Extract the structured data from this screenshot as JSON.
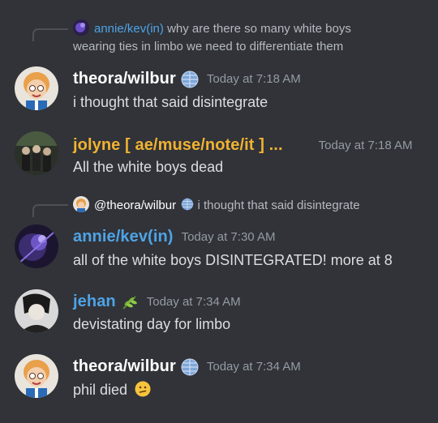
{
  "messages": [
    {
      "reply": {
        "author": "annie/kev(in)",
        "text": "why are there so many white boys wearing ties in limbo we need to differentiate them"
      },
      "author": "theora/wilbur",
      "time": "Today at 7:18 AM",
      "content": "i thought that said disintegrate"
    },
    {
      "author": "jolyne [ ae/muse/note/it ] ...",
      "time": "Today at 7:18 AM",
      "content": "All the white boys dead"
    },
    {
      "reply": {
        "author": "@theora/wilbur",
        "text": "i thought that said disintegrate"
      },
      "author": "annie/kev(in)",
      "time": "Today at 7:30 AM",
      "content": "all of the white boys DISINTEGRATED! more at 8"
    },
    {
      "author": "jehan",
      "time": "Today at 7:34 AM",
      "content": "devistating day for limbo"
    },
    {
      "author": "theora/wilbur",
      "time": "Today at 7:34 AM",
      "content": "phil died"
    }
  ],
  "colors": {
    "background": "#313338",
    "text": "#dbdee1",
    "timestamp": "#949ba4",
    "theora": "#ffffff",
    "jolyne": "#f0b232",
    "annie": "#4ea3e6",
    "jehan": "#4ea3e6"
  },
  "icons": {
    "disco-badge": "disco-ball-icon",
    "leaf-badge": "herb-icon",
    "confused-emoji": "confused-face-emoji"
  }
}
